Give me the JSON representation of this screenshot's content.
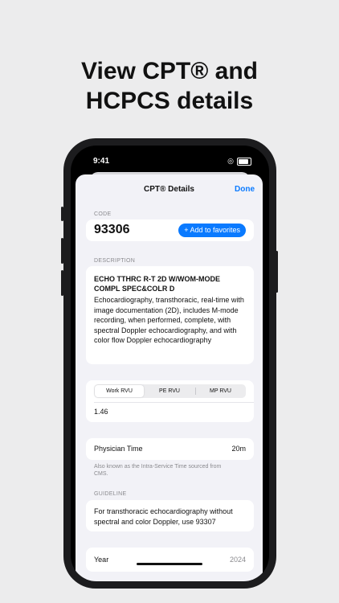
{
  "headline": {
    "line1": "View CPT® and",
    "line2": "HCPCS details"
  },
  "status_bar": {
    "time": "9:41"
  },
  "nav": {
    "title": "CPT® Details",
    "done_label": "Done"
  },
  "code": {
    "label": "CODE",
    "value": "93306",
    "favorite_label": "+ Add to favorites"
  },
  "description": {
    "label": "DESCRIPTION",
    "short": "ECHO TTHRC R-T 2D W/WOM-MODE COMPL SPEC&COLR D",
    "long": "Echocardiography, transthoracic, real-time with image documentation (2D), includes M-mode recording, when performed, complete, with spectral Doppler echocardiography, and with color flow Doppler echocardiography"
  },
  "rvu": {
    "tabs": [
      "Work RVU",
      "PE RVU",
      "MP RVU"
    ],
    "selected": "Work RVU",
    "value": "1.46"
  },
  "physician_time": {
    "label": "Physician Time",
    "value": "20m",
    "note": "Also known as the Intra-Service Time sourced from CMS."
  },
  "guideline": {
    "label": "GUIDELINE",
    "text": "For transthoracic echocardiography without spectral and color Doppler, use 93307"
  },
  "year": {
    "label": "Year",
    "value": "2024"
  },
  "colors": {
    "accent": "#0a7aff",
    "background": "#ececed",
    "sheet": "#f2f2f7"
  }
}
